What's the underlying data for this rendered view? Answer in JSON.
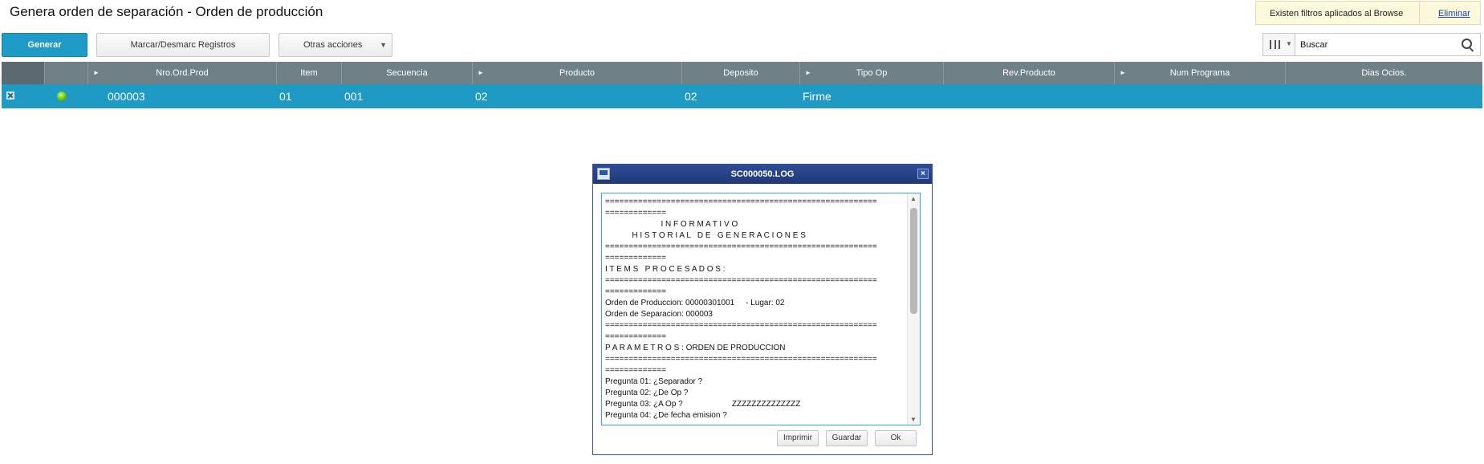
{
  "page": {
    "title": "Genera orden de separación - Orden de producción"
  },
  "filter_notice": {
    "message": "Existen filtros aplicados al Browse",
    "remove_link": "Eliminar"
  },
  "toolbar": {
    "generate_label": "Generar",
    "mark_label": "Marcar/Desmarc Registros",
    "other_actions_label": "Otras acciones"
  },
  "search": {
    "value": "Buscar",
    "icon": "search-icon",
    "columns_icon": "columns-icon"
  },
  "grid": {
    "columns": [
      "",
      "",
      "Nro.Ord.Prod",
      "Item",
      "Secuencia",
      "Producto",
      "Deposito",
      "Tipo Op",
      "Rev.Producto",
      "Num Programa",
      "Dias Ocios."
    ],
    "rows": [
      {
        "nro_ord_prod": "000003",
        "item": "01",
        "secuencia": "001",
        "producto": "02",
        "deposito": "02",
        "tipo_op": "Firme",
        "rev_producto": "",
        "num_programa": "",
        "dias_ocios": "",
        "status": "green"
      }
    ]
  },
  "dialog": {
    "title": "SC000050.LOG",
    "log_text": "==========================================================\n=============\n                         I N F O R M A T I V O\n            H I S T O R I A L   D E   G E N E R A C I O N E S\n==========================================================\n=============\nI T E M S   P R O C E S A D O S :\n==========================================================\n=============\nOrden de Produccion: 00000301001     - Lugar: 02\nOrden de Separacion: 000003\n==========================================================\n=============\nP A R A M E T R O S : ORDEN DE PRODUCCION\n==========================================================\n=============\nPregunta 01: ¿Separador ?\nPregunta 02: ¿De Op ?\nPregunta 03: ¿A Op ?                      ZZZZZZZZZZZZZZ\nPregunta 04: ¿De fecha emision ?",
    "print_label": "Imprimir",
    "save_label": "Guardar",
    "ok_label": "Ok"
  },
  "colors": {
    "accent": "#1e9bc7",
    "header_bg": "#6f8087",
    "dialog_title": "#2f4c98",
    "status_ok": "#5fba12"
  }
}
